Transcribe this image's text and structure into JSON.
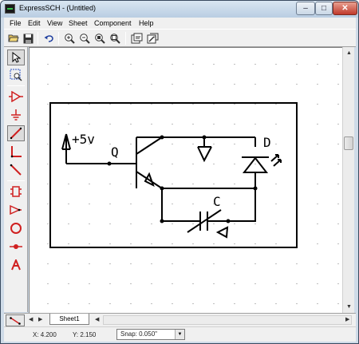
{
  "window": {
    "title": "ExpressSCH - (Untitled)",
    "min_label": "–",
    "max_label": "□",
    "close_label": "✕"
  },
  "menu": [
    "File",
    "Edit",
    "View",
    "Sheet",
    "Component",
    "Help"
  ],
  "toolbar": {
    "icons": [
      "open-icon",
      "save-icon",
      "undo-icon",
      "zoom-in-icon",
      "zoom-out-icon",
      "zoom-area-icon",
      "zoom-fit-icon",
      "sheet-properties-icon",
      "component-properties-icon"
    ]
  },
  "left_toolbar": {
    "tools": [
      "pointer-tool",
      "zoom-select-tool",
      "buffer-tool",
      "ground-tool",
      "wire-tool",
      "bus-tool",
      "bus-entry-tool",
      "component-tool",
      "port-tool",
      "circle-tool",
      "junction-tool",
      "text-tool"
    ]
  },
  "schematic": {
    "supply_label": "+5v",
    "transistor_label": "Q",
    "led_label": "D",
    "capacitor_label": "C"
  },
  "sheet_tabs": [
    "Sheet1"
  ],
  "status": {
    "x": "X: 4.200",
    "y": "Y: 2.150",
    "snap": "Snap: 0.050\""
  },
  "colors": {
    "tool_red": "#d02020",
    "window_frame": "#cfdbe8"
  }
}
